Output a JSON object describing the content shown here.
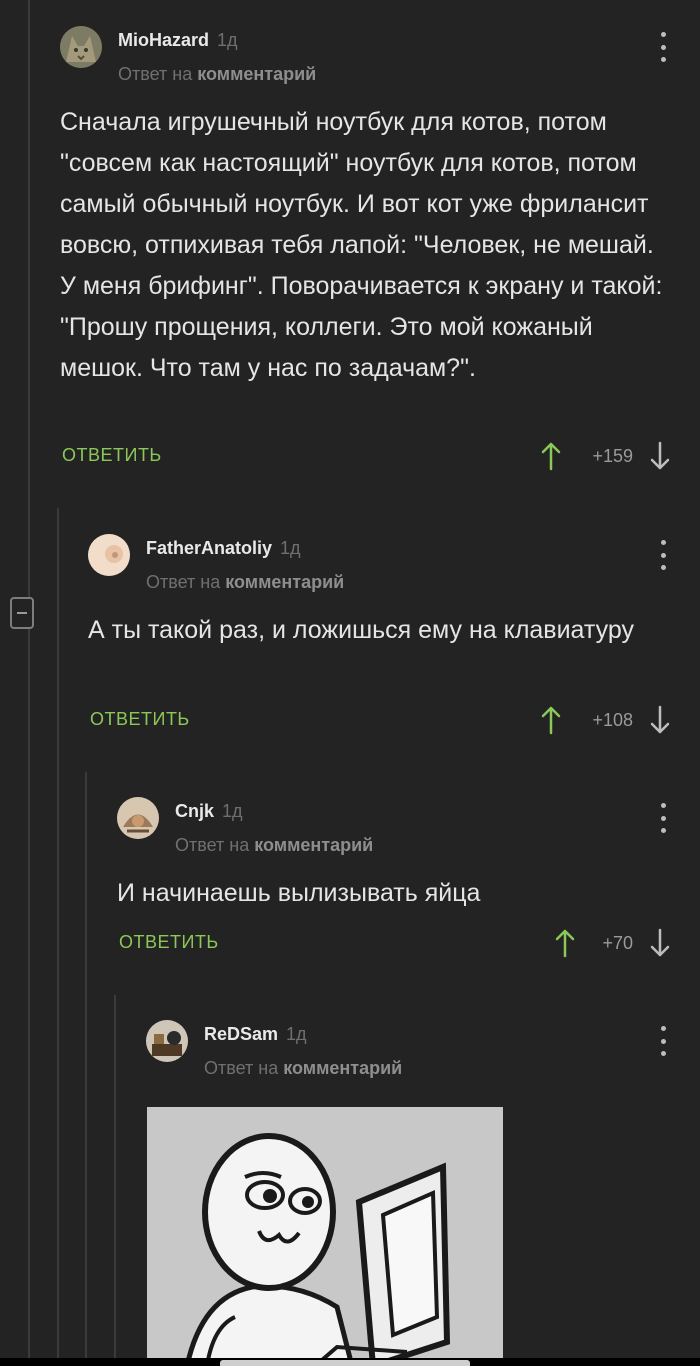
{
  "labels": {
    "reply_prefix": "Ответ на",
    "reply_target": "комментарий",
    "reply_button": "ОТВЕТИТЬ"
  },
  "comments": [
    {
      "author": "MioHazard",
      "age": "1д",
      "text": "Сначала игрушечный ноутбук для котов, потом \"совсем как настоящий\" ноутбук для котов, потом самый обычный ноутбук. И вот кот уже фрилансит вовсю, отпихивая тебя лапой: \"Человек, не мешай. У меня брифинг\". Поворачивается к экрану и такой: \"Прошу прощения, коллеги. Это мой кожаный мешок. Что там у нас по задачам?\".",
      "score": "+159"
    },
    {
      "author": "FatherAnatoliy",
      "age": "1д",
      "text": "А ты такой раз, и ложишься ему на клавиатуру",
      "score": "+108"
    },
    {
      "author": "Cnjk",
      "age": "1д",
      "text": "И начинаешь вылизывать яйца",
      "score": "+70"
    },
    {
      "author": "ReDSam",
      "age": "1д",
      "text": "",
      "score": ""
    }
  ],
  "colors": {
    "background": "#232323",
    "accent_green": "#8ac858",
    "thread_line": "#3b3b3b"
  },
  "icons": {
    "vote_up": "arrow-up-icon",
    "vote_down": "arrow-down-icon",
    "menu": "more-vertical-icon",
    "collapse": "minus-square-icon"
  }
}
